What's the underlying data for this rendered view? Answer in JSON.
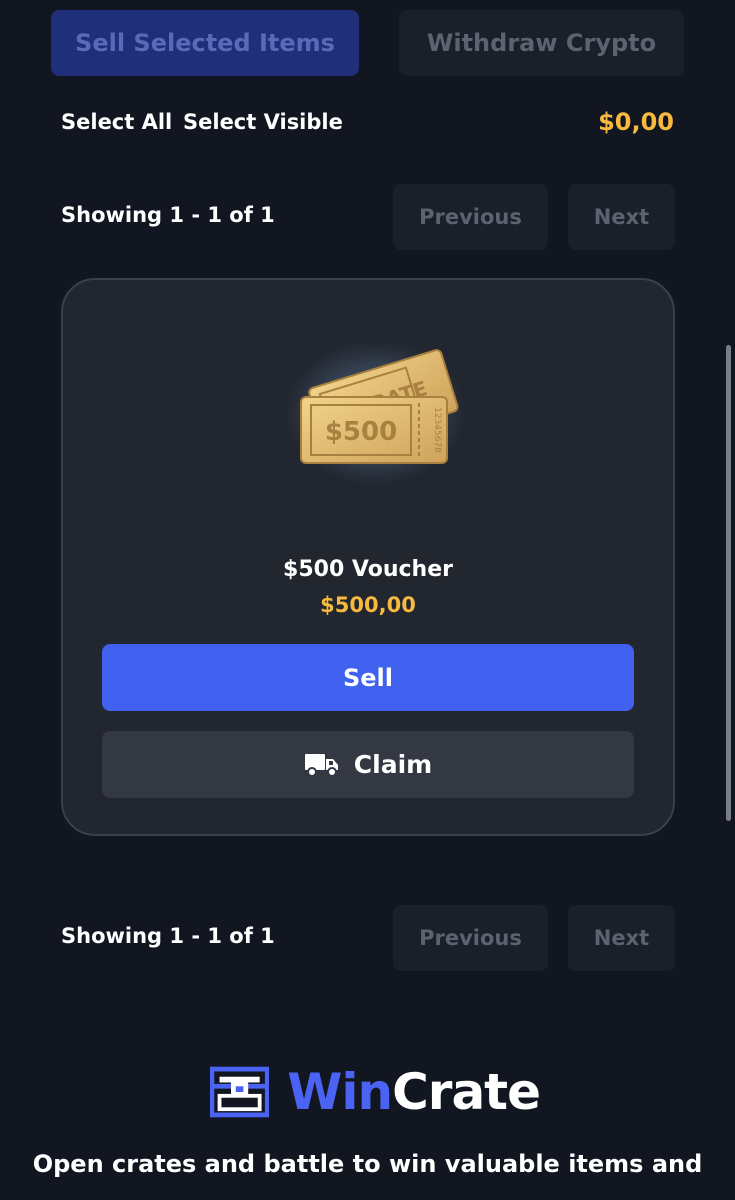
{
  "actions": {
    "sell_selected_label": "Sell Selected Items",
    "withdraw_label": "Withdraw Crypto"
  },
  "selection": {
    "select_all_label": "Select All",
    "select_visible_label": "Select Visible",
    "total_value": "$0,00"
  },
  "pagination_top": {
    "showing_text": "Showing 1 - 1 of 1",
    "previous_label": "Previous",
    "next_label": "Next"
  },
  "item": {
    "name": "$500 Voucher",
    "price": "$500,00",
    "ticket_brand": "WINCRATE",
    "ticket_amount": "$500",
    "serial_number": "12345678",
    "sell_label": "Sell",
    "claim_label": "Claim",
    "claim_icon": "truck-icon"
  },
  "pagination_bottom": {
    "showing_text": "Showing 1 - 1 of 1",
    "previous_label": "Previous",
    "next_label": "Next"
  },
  "footer": {
    "logo_word_1": "Win",
    "logo_word_2": "Crate",
    "logo_icon": "treasure-chest-icon",
    "tagline": "Open crates and battle to win valuable items and"
  },
  "colors": {
    "background": "#111620",
    "accent_blue": "#4061f0",
    "gold": "#f7b93e",
    "card": "#22262f"
  }
}
